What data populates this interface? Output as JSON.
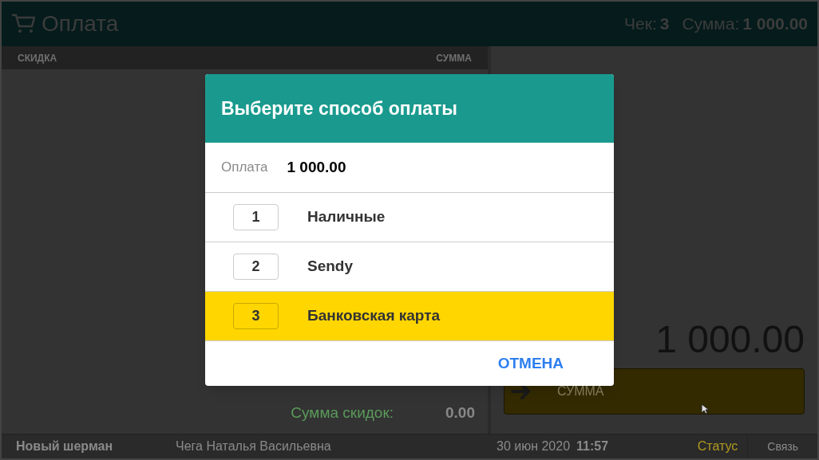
{
  "header": {
    "title": "Оплата",
    "check_label": "Чек:",
    "check_value": "3",
    "sum_label": "Сумма:",
    "sum_value": "1 000.00"
  },
  "table": {
    "columns": [
      "СКИДКА",
      "СУММА"
    ]
  },
  "totals": [
    {
      "label": "Сумма скидок:",
      "value": "0.00"
    }
  ],
  "amount": "1 000.00",
  "pay_button": {
    "label": "СУММА"
  },
  "status_bar": {
    "store": "Новый шерман",
    "cashier": "Чега Наталья Васильевна",
    "date": "30 июн 2020",
    "time": "11:57",
    "status": "Статус",
    "connection": "Связь"
  },
  "dialog": {
    "title": "Выберите способ оплаты",
    "payment_label": "Оплата",
    "payment_value": "1 000.00",
    "options": [
      {
        "key": "1",
        "label": "Наличные",
        "selected": false
      },
      {
        "key": "2",
        "label": "Sendy",
        "selected": false
      },
      {
        "key": "3",
        "label": "Банковская карта",
        "selected": true
      }
    ],
    "cancel": "ОТМЕНА"
  }
}
